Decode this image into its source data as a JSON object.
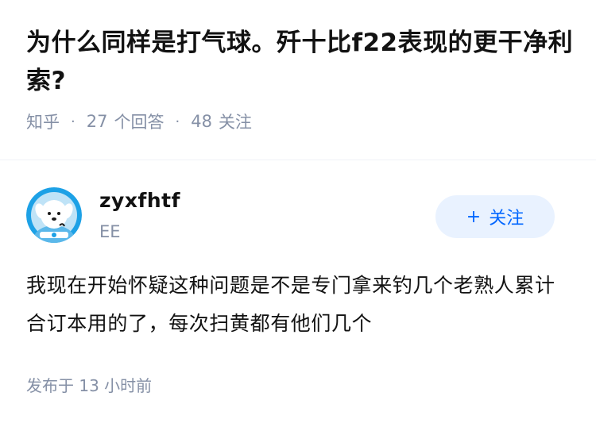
{
  "question": {
    "title": "为什么同样是打气球。歼十比f22表现的更干净利索?",
    "source": "知乎",
    "answers_count": "27",
    "answers_label": "个回答",
    "followers_count": "48",
    "followers_label": "关注"
  },
  "author": {
    "name": "zyxfhtf",
    "bio": "EE",
    "follow_label": "关注",
    "avatar_icon": "cartoon-dog-avatar-icon"
  },
  "answer": {
    "content": "我现在开始怀疑这种问题是不是专门拿来钓几个老熟人累计合订本用的了，每次扫黄都有他们几个",
    "time_prefix": "发布于",
    "time_value": "13 小时前"
  },
  "colors": {
    "accent": "#0066ff",
    "button_bg": "#e9f2ff",
    "meta_text": "#8590a6",
    "primary_text": "#121212"
  }
}
